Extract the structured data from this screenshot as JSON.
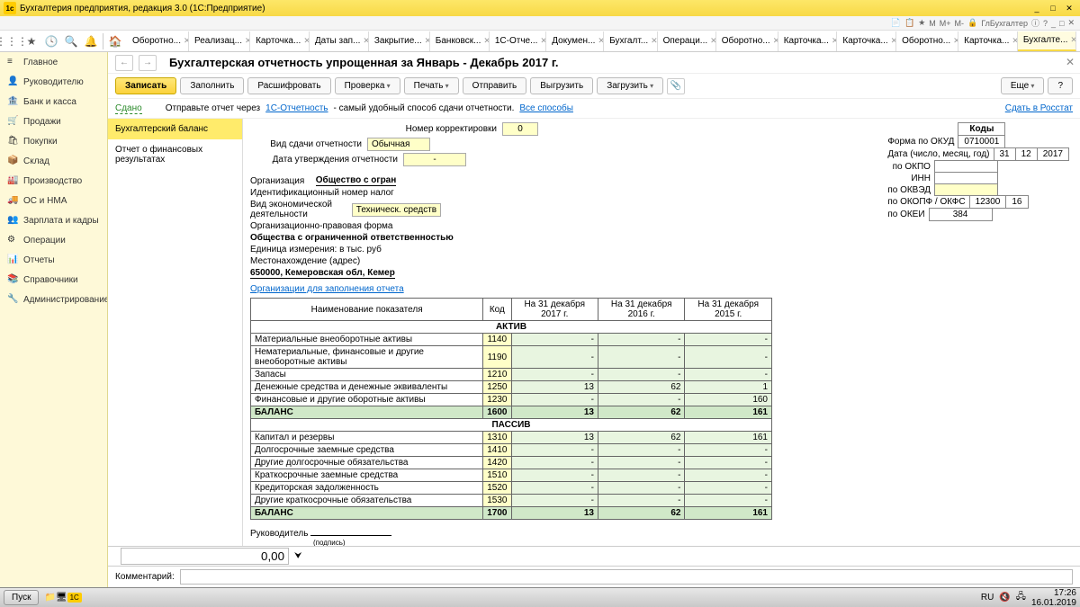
{
  "window": {
    "title": "Бухгалтерия предприятия, редакция 3.0 (1С:Предприятие)",
    "ico": "1c"
  },
  "topicons": [
    "☰",
    "📄",
    "📋",
    "★",
    "M",
    "M+",
    "M-",
    "🔒",
    "ГлБухгалтер",
    "ⓘ",
    "?",
    "_",
    "□",
    "✕"
  ],
  "toolbar_tabs": [
    "Оборотно...",
    "Реализац...",
    "Карточка...",
    "Даты зап...",
    "Закрытие...",
    "Банковск...",
    "1С-Отче...",
    "Докумен...",
    "Бухгалт...",
    "Операци...",
    "Оборотно...",
    "Карточка...",
    "Карточка...",
    "Оборотно...",
    "Карточка...",
    "Бухгалте..."
  ],
  "active_tab_index": 15,
  "sidebar": [
    {
      "ic": "≡",
      "label": "Главное"
    },
    {
      "ic": "👤",
      "label": "Руководителю"
    },
    {
      "ic": "🏦",
      "label": "Банк и касса"
    },
    {
      "ic": "🛒",
      "label": "Продажи"
    },
    {
      "ic": "🛍",
      "label": "Покупки"
    },
    {
      "ic": "📦",
      "label": "Склад"
    },
    {
      "ic": "🏭",
      "label": "Производство"
    },
    {
      "ic": "🚚",
      "label": "ОС и НМА"
    },
    {
      "ic": "👥",
      "label": "Зарплата и кадры"
    },
    {
      "ic": "⚙",
      "label": "Операции"
    },
    {
      "ic": "📊",
      "label": "Отчеты"
    },
    {
      "ic": "📚",
      "label": "Справочники"
    },
    {
      "ic": "🔧",
      "label": "Администрирование"
    }
  ],
  "page_title": "Бухгалтерская отчетность упрощенная за Январь - Декабрь 2017 г.",
  "buttons": {
    "zapisat": "Записать",
    "zapolnit": "Заполнить",
    "rasshifrovat": "Расшифровать",
    "proverka": "Проверка",
    "pechat": "Печать",
    "otpravit": "Отправить",
    "vygruzit": "Выгрузить",
    "zagruzit": "Загрузить",
    "eshe": "Еще",
    "q": "?"
  },
  "info": {
    "sdano": "Сдано",
    "text": "Отправьте отчет через ",
    "link1": "1С-Отчетность",
    "text2": " - самый удобный способ сдачи отчетности. ",
    "link2": "Все способы",
    "rosstat": "Сдать в Росстат"
  },
  "sections": [
    {
      "label": "Бухгалтерский баланс",
      "active": true
    },
    {
      "label": "Отчет о финансовых результатах",
      "active": false
    }
  ],
  "form": {
    "corr_label": "Номер корректировки",
    "corr": "0",
    "vid_label": "Вид сдачи отчетности",
    "vid": "Обычная",
    "date_label": "Дата утверждения отчетности",
    "date": "-",
    "org_label": "Организация",
    "org": "Общество с огран",
    "inn_label": "Идентификационный номер налог",
    "ved_label": "Вид экономической деятельности",
    "ved": "Техническ. средств",
    "form_label": "Организационно-правовая форма",
    "form": "Общества с ограниченной ответственностью",
    "ed_label": "Единица измерения:",
    "ed": "в тыс. руб",
    "addr_label": "Местонахождение (адрес)",
    "addr": "650000, Кемеровская обл, Кемер",
    "orglink": "Организации для заполнения отчета"
  },
  "codes": {
    "header": "Коды",
    "okud_label": "Форма по ОКУД",
    "okud": "0710001",
    "date_label": "Дата (число, месяц, год)",
    "d": "31",
    "m": "12",
    "y": "2017",
    "okpo_label": "по ОКПО",
    "okpo": "",
    "inn_label": "ИНН",
    "inn": "",
    "okved_label": "по ОКВЭД",
    "okved": "",
    "okopf_label": "по ОКОПФ / ОКФС",
    "okopf": "12300",
    "okfs": "16",
    "okei_label": "по ОКЕИ",
    "okei": "384"
  },
  "table": {
    "headers": [
      "Наименование показателя",
      "Код",
      "На 31 декабря 2017 г.",
      "На 31 декабря 2016 г.",
      "На 31 декабря 2015 г."
    ],
    "aktiv": "АКТИВ",
    "passiv": "ПАССИВ",
    "rows_a": [
      {
        "name": "Материальные внеоборотные активы",
        "code": "1140",
        "v": [
          "-",
          "-",
          "-"
        ]
      },
      {
        "name": "Нематериальные, финансовые и другие внеоборотные активы",
        "code": "1190",
        "v": [
          "-",
          "-",
          "-"
        ]
      },
      {
        "name": "Запасы",
        "code": "1210",
        "v": [
          "-",
          "-",
          "-"
        ]
      },
      {
        "name": "Денежные средства и денежные эквиваленты",
        "code": "1250",
        "v": [
          "13",
          "62",
          "1"
        ]
      },
      {
        "name": "Финансовые и другие оборотные активы",
        "code": "1230",
        "v": [
          "-",
          "-",
          "160"
        ]
      }
    ],
    "balance_a": {
      "name": "БАЛАНС",
      "code": "1600",
      "v": [
        "13",
        "62",
        "161"
      ]
    },
    "rows_p": [
      {
        "name": "Капитал и резервы",
        "code": "1310",
        "v": [
          "13",
          "62",
          "161"
        ]
      },
      {
        "name": "Долгосрочные заемные средства",
        "code": "1410",
        "v": [
          "-",
          "-",
          "-"
        ]
      },
      {
        "name": "Другие долгосрочные обязательства",
        "code": "1420",
        "v": [
          "-",
          "-",
          "-"
        ]
      },
      {
        "name": "Краткосрочные заемные средства",
        "code": "1510",
        "v": [
          "-",
          "-",
          "-"
        ]
      },
      {
        "name": "Кредиторская задолженность",
        "code": "1520",
        "v": [
          "-",
          "-",
          "-"
        ]
      },
      {
        "name": "Другие краткосрочные обязательства",
        "code": "1530",
        "v": [
          "-",
          "-",
          "-"
        ]
      }
    ],
    "balance_p": {
      "name": "БАЛАНС",
      "code": "1700",
      "v": [
        "13",
        "62",
        "161"
      ]
    }
  },
  "sign": {
    "label": "Руководитель",
    "sub": "(подпись)"
  },
  "bottom": {
    "value": "0,00",
    "comment_label": "Комментарий:",
    "comment": ""
  },
  "taskbar": {
    "start": "Пуск",
    "lang": "RU",
    "time": "17:26",
    "date": "16.01.2019"
  }
}
